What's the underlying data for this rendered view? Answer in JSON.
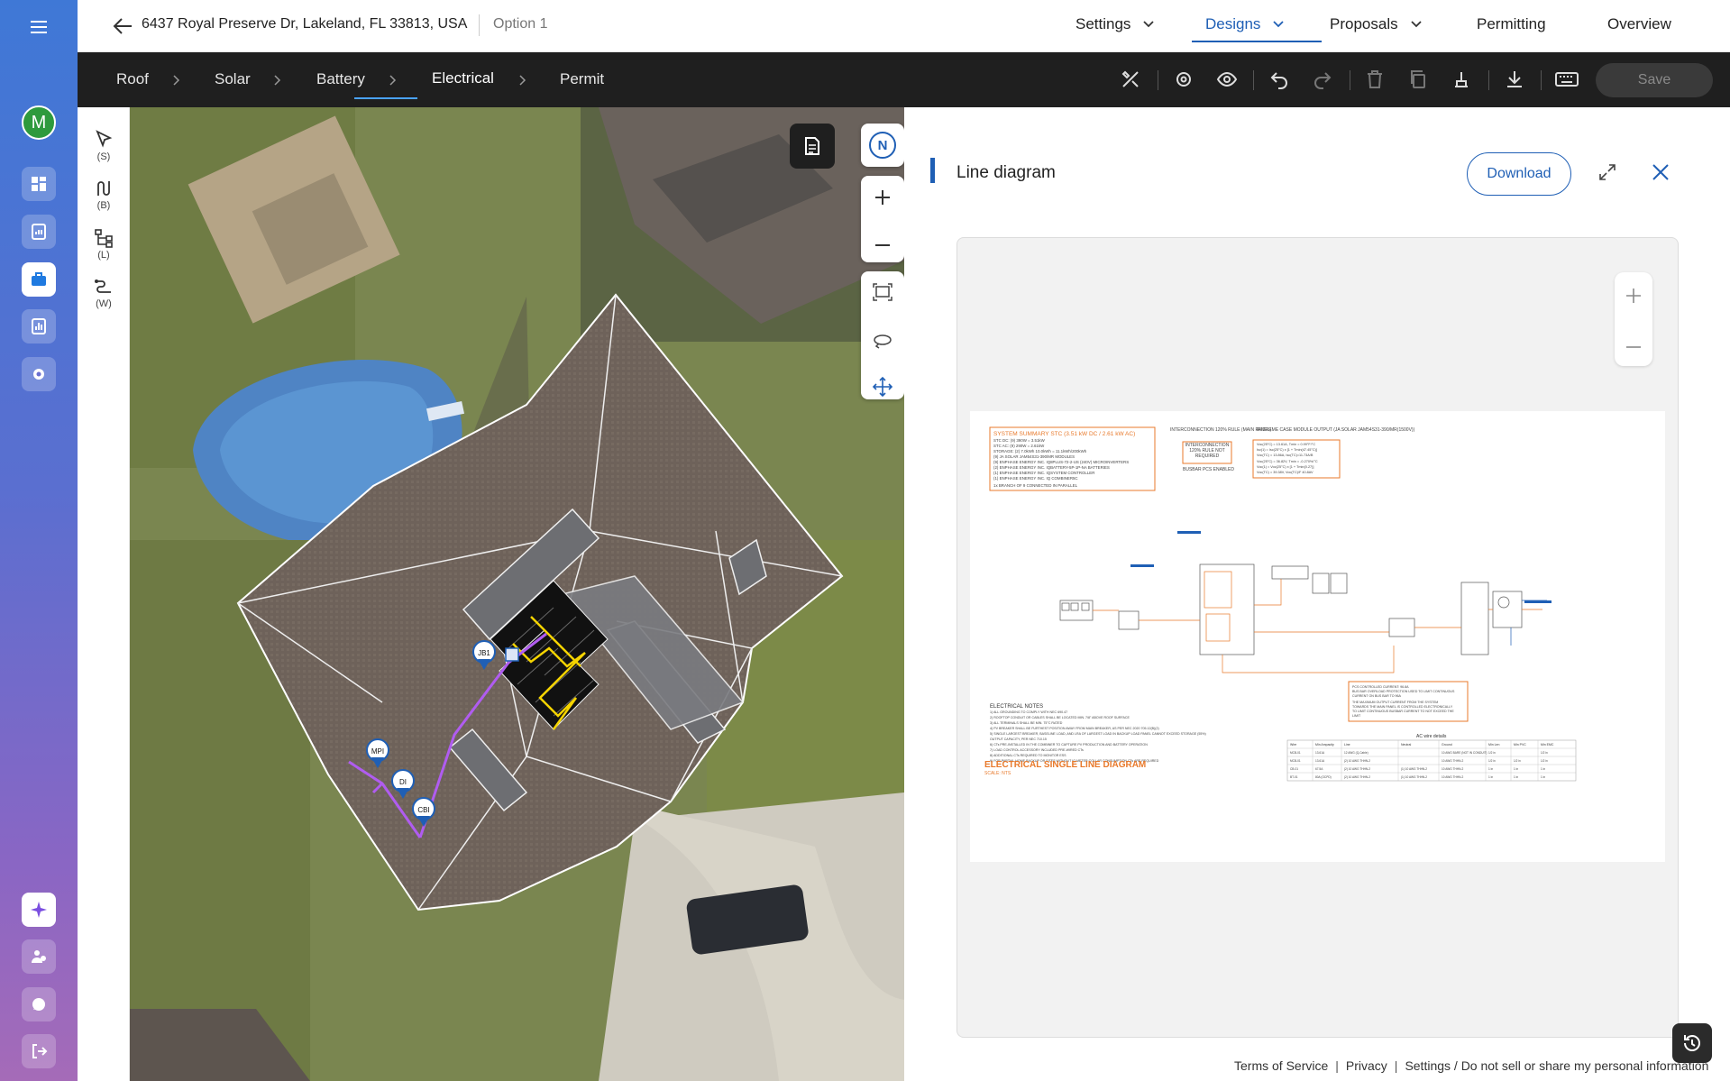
{
  "header": {
    "address": "6437 Royal Preserve Dr, Lakeland, FL 33813, USA",
    "option": "Option 1",
    "nav": [
      {
        "label": "Settings",
        "has_menu": true
      },
      {
        "label": "Designs",
        "has_menu": true,
        "active": true
      },
      {
        "label": "Proposals",
        "has_menu": true
      },
      {
        "label": "Permitting",
        "has_menu": false
      },
      {
        "label": "Overview",
        "has_menu": false
      }
    ]
  },
  "sidebar": {
    "avatar_initial": "M",
    "items": [
      {
        "icon": "dashboard-icon"
      },
      {
        "icon": "report-icon"
      },
      {
        "icon": "briefcase-icon",
        "active": true
      },
      {
        "icon": "bar-chart-icon"
      },
      {
        "icon": "gear-icon"
      }
    ],
    "bottom_items": [
      {
        "icon": "sparkle-icon"
      },
      {
        "icon": "users-icon"
      },
      {
        "icon": "chat-icon"
      },
      {
        "icon": "logout-icon"
      }
    ]
  },
  "steps": {
    "items": [
      {
        "label": "Roof"
      },
      {
        "label": "Solar"
      },
      {
        "label": "Battery"
      },
      {
        "label": "Electrical",
        "active": true
      },
      {
        "label": "Permit"
      }
    ],
    "save_label": "Save"
  },
  "tools": [
    {
      "shortcut": "(S)",
      "icon": "select-arrow-icon"
    },
    {
      "shortcut": "(B)",
      "icon": "wire-branch-icon"
    },
    {
      "shortcut": "(L)",
      "icon": "line-tree-icon"
    },
    {
      "shortcut": "(W)",
      "icon": "wire-icon"
    }
  ],
  "map": {
    "compass": "N",
    "markers": [
      {
        "label": "JB1"
      },
      {
        "label": "MPI"
      },
      {
        "label": "DI"
      },
      {
        "label": "CBI"
      }
    ]
  },
  "line_diagram": {
    "title": "Line diagram",
    "download_label": "Download",
    "sheet": {
      "summary_title": "SYSTEM SUMMARY STC (3.51 kW DC / 2.61 kW AC)",
      "summary_lines": [
        "STC DC: (9) 390W = 3.51kW",
        "STC AC: (9) 290W = 2.61kW",
        "STORAGE: (2) 7.0kWh 10.0kWh = 11.1kWh/200kWh",
        "(9) JA SOLAR JAM54S31-390/MR MODULES",
        "(9) ENPHASE ENERGY INC. IQ8PLUS-72-2-US (240V) MICROINVERTERS",
        "(2) ENPHASE ENERGY INC. IQBATTERY-5P-1P-NA BATTERIES",
        "(1) ENPHASE ENERGY INC. IQSYSTEM CONTROLLER",
        "(1) ENPHASE ENERGY INC. IQ COMBINER5C",
        "1x BRANCH OF 9 CONNECTED IN PARALLEL"
      ],
      "interconnection_title": "INTERCONNECTION 120% RULE (MAIN PANEL)",
      "interconnection_box": "INTERCONNECTION 120% RULE NOT REQUIRED",
      "interconnection_note": "BUSBAR PCS ENABLED",
      "extreme_title": "EXTREME CASE MODULE OUTPUT (JA SOLAR JAM54S31-390/MR(1500V))",
      "extreme_lines": [
        "Voc(25°C) = 13.61A, Tmin = 0.99°F/°C",
        "Isc(1) = Isc(25°C) x [1 + Tmin(47.45°C)]",
        "Voc(TC) = 13.86A, Isc(TC)=11.73A/B",
        "Voc(25°C) = 36.82V, Tmin = -0.270%/°C",
        "Voc(1) = Voc(25°C) x [1 + Tmin(0.27)]",
        "Voc(TC) = 39.38V, Voc(TC)/F 40.8AV"
      ],
      "pcs_lines": [
        "PCS CONTROLLED CURRENT: 96.8A",
        "BUS BAR OVERLOAD PROTECTION USED TO LIMIT CONTINUOUS",
        "CURRENT ON BUS BAR TO 96A",
        "THE MAXIMUM OUTPUT CURRENT FROM THE SYSTEM",
        "TOWARDS THE MAIN PANEL IS CONTROLLED ELECTRONICALLY",
        "TO LIMIT CONTINUOUS BUSBAR CURRENT TO NOT EXCEED THE",
        "LIMIT"
      ],
      "notes_title": "ELECTRICAL NOTES",
      "notes": [
        "1) ALL GROUNDING TO COMPLY WITH NEC 690.47",
        "2) ROOFTOP CONDUIT OR CABLES SHALL BE LOCATED MIN. 7/8\" ABOVE ROOF SURFACE",
        "3) ALL TERMINALS SHALL BE MIN. 75°C RATED",
        "4) PV BREAKER SHALL BE FURTHEST POSITION AWAY FROM MAIN BREAKER, AS PER NEC 2020 705.12(B)(2)",
        "5) SINGLE LARGEST BREAKER, BASELINE LOAD, AND LRA OF LARGEST LOAD IN BACKUP LOAD PANEL CANNOT EXCEED STORAGE (55%)",
        "   OUTPUT CAPACITY, PER NEC 710.15",
        "6) CTs PRE-INSTALLED IN THE COMBINER TO CAPTURE PV PRODUCTION AND BATTERY OPERATION",
        "7) LOAD CONTROL ACCESSORY INCLUDED PRE-WIRED CTs",
        "8) ADDITIONAL CTs REQUIRED TO MONITOR ESS",
        "9) FOR PARTIAL HOME BACKUP OR SITES WITHOUT IQ METER COLLAR CONSUMPTION CTs ARE REQUIRED"
      ],
      "diagram_title": "ELECTRICAL SINGLE LINE DIAGRAM",
      "scale": "SCALE: NTS",
      "table_title": "AC wire details",
      "table_headers": [
        "Wire",
        "Min Ampacity",
        "Line",
        "Neutral",
        "Ground",
        "Min Len",
        "Min PVC",
        "Min EMC"
      ],
      "table_rows": [
        [
          "MCB-01",
          "13.61A",
          "12 AWG (Q-Cable)",
          "",
          "10 AWG BARE (NOT IN CONDUIT)",
          "1/2 in",
          "",
          "1/2 in"
        ],
        [
          "MCB-01",
          "13.61A",
          "(2) 10 AWG THHN-2",
          "",
          "10 AWG THHN-2",
          "1/2 in",
          "1/2 in",
          "1/2 in"
        ],
        [
          "CB-01",
          "67.5A",
          "(2) 10 AWG THHN-2",
          "(1) 10 AWG THHN-2",
          "10 AWG THHN-2",
          "1 in",
          "1 in",
          "1 in"
        ],
        [
          "BT-01",
          "80A (OCPD)",
          "(2) 10 AWG THHN-2",
          "(1) 10 AWG THHN-2",
          "10 AWG THHN-2",
          "1 in",
          "1 in",
          "1 in"
        ]
      ]
    }
  },
  "footer": {
    "links": [
      "Terms of Service",
      "Privacy",
      "Settings / Do not sell or share my personal information"
    ]
  },
  "colors": {
    "brand_blue": "#1f5fb5",
    "step_bar": "#1f1f1f",
    "wire_purple": "#b05cf0",
    "diagram_orange": "#e8792b"
  }
}
